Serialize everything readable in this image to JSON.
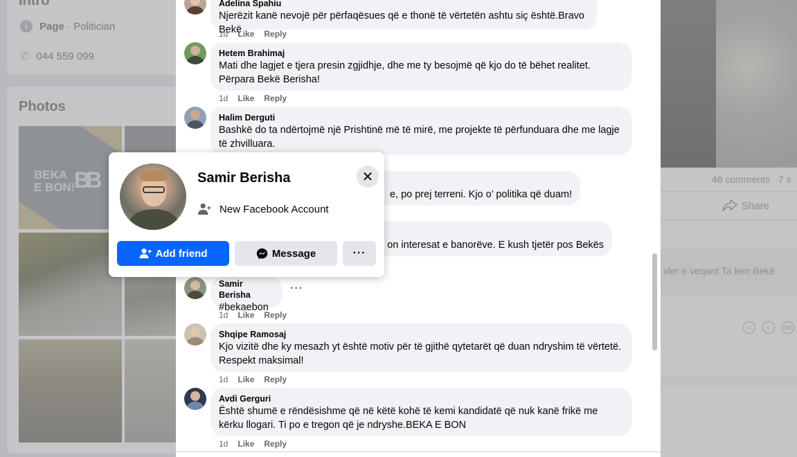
{
  "intro": {
    "title": "Intro",
    "page_label": "Page",
    "page_category": "· Politician",
    "phone": "044 559 099"
  },
  "photos": {
    "title": "Photos",
    "logo_line1": "BEKA",
    "logo_line2": "E BON!",
    "logo_mark": "BB"
  },
  "right_post": {
    "comments_count": "46 comments",
    "shares_count": "7 s",
    "share_label": "Share",
    "comment_preview": "vler e veqant Ta ken Bekë",
    "icons": [
      "sticker-icon",
      "emoji-icon",
      "gif-icon"
    ]
  },
  "comments": [
    {
      "author": "Adelina Spahiu",
      "text": "Njerëzit kanë nevojë për përfaqësues që e thonë të vërtetën ashtu siç është.Bravo Bekë",
      "time": "1d",
      "like": "Like",
      "reply": "Reply"
    },
    {
      "author": "Hetem Brahimaj",
      "text": "Mati dhe lagjet e tjera presin zgjidhje, dhe me ty besojmë që kjo do të bëhet realitet. Përpara Bekë Berisha!",
      "time": "1d",
      "like": "Like",
      "reply": "Reply"
    },
    {
      "author": "Halim Derguti",
      "text": "Bashkë do ta ndërtojmë një Prishtinë më të mirë, me projekte të përfunduara dhe me lagje të zhvilluara.",
      "time": "1d",
      "like": "Like",
      "reply": "Reply"
    },
    {
      "author": "",
      "text": "e, po prej terreni. Kjo o’ politika që duam!",
      "time": "",
      "like": "",
      "reply": ""
    },
    {
      "author": "",
      "text": "on interesat e banorëve. E kush tjetër pos Bekës",
      "time": "",
      "like": "",
      "reply": ""
    },
    {
      "author": "Samir Berisha",
      "text": "#bekaebon",
      "time": "1d",
      "like": "Like",
      "reply": "Reply"
    },
    {
      "author": "Shqipe Ramosaj",
      "text": "Kjo vizitë dhe ky mesazh yt është motiv për të gjithë qytetarët që duan ndryshim të vërtetë. Respekt maksimal!",
      "time": "1d",
      "like": "Like",
      "reply": "Reply"
    },
    {
      "author": "Avdi Gerguri",
      "text": "Është shumë e rëndësishme që në këtë kohë të kemi kandidatë që nuk kanë frikë me kërku llogari. Ti po e tregon që je ndryshe.BEKA E BON",
      "time": "1d",
      "like": "Like",
      "reply": "Reply"
    }
  ],
  "hovercard": {
    "name": "Samir Berisha",
    "subtitle": "New Facebook Account",
    "add_friend": "Add friend",
    "message": "Message",
    "more": "···",
    "close": "✕"
  },
  "colors": {
    "primary": "#0866ff",
    "bubble": "#f0f2f5",
    "secondary_button": "#e4e6eb",
    "muted_text": "#65676b"
  }
}
